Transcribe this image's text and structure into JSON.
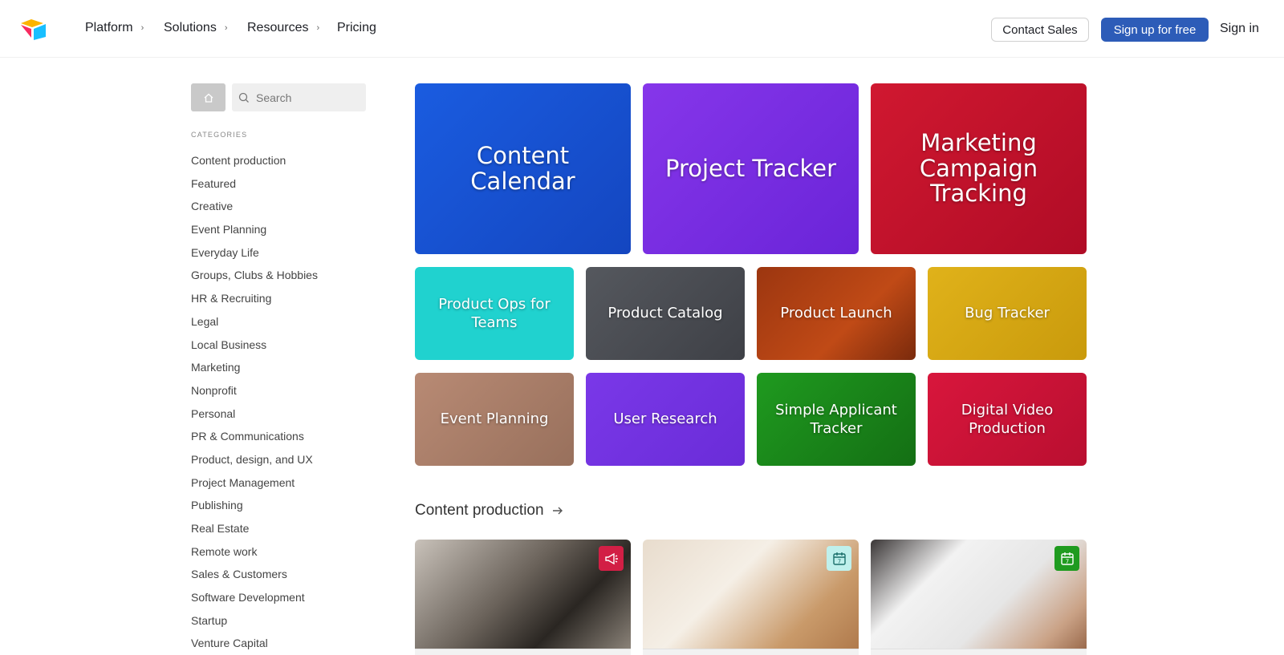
{
  "header": {
    "logo_icon": "airtable-logo-icon",
    "nav": [
      {
        "label": "Platform",
        "has_chevron": true
      },
      {
        "label": "Solutions",
        "has_chevron": true
      },
      {
        "label": "Resources",
        "has_chevron": true
      },
      {
        "label": "Pricing",
        "has_chevron": false
      }
    ],
    "contact_sales": "Contact Sales",
    "signup": "Sign up for free",
    "signin": "Sign in",
    "colors": {
      "signup_bg": "#2d5cb8"
    }
  },
  "sidebar": {
    "home_icon": "home-icon",
    "search_icon": "search-icon",
    "search_placeholder": "Search",
    "categories_label": "CATEGORIES",
    "categories": [
      "Content production",
      "Featured",
      "Creative",
      "Event Planning",
      "Everyday Life",
      "Groups, Clubs & Hobbies",
      "HR & Recruiting",
      "Legal",
      "Local Business",
      "Marketing",
      "Nonprofit",
      "Personal",
      "PR & Communications",
      "Product, design, and UX",
      "Project Management",
      "Publishing",
      "Real Estate",
      "Remote work",
      "Sales & Customers",
      "Software Development",
      "Startup",
      "Venture Capital"
    ]
  },
  "featured": {
    "big": [
      {
        "title": "Content Calendar",
        "color": "#1653d6"
      },
      {
        "title": "Project Tracker",
        "color": "#7a2ee3"
      },
      {
        "title": "Marketing Campaign Tracking",
        "color": "#c8102e"
      }
    ],
    "row2": [
      {
        "title": "Product Ops for Teams",
        "color": "#1fd1d1"
      },
      {
        "title": "Product Catalog",
        "color": "#4d5056"
      },
      {
        "title": "Product Launch",
        "color": "#a23a10"
      },
      {
        "title": "Bug Tracker",
        "color": "#d6a812"
      }
    ],
    "row3": [
      {
        "title": "Event Planning",
        "color": "#a87a66"
      },
      {
        "title": "User Research",
        "color": "#7a35e6"
      },
      {
        "title": "Simple Applicant Tracker",
        "color": "#1c8a1c"
      },
      {
        "title": "Digital Video Production",
        "color": "#d0163a"
      }
    ]
  },
  "section": {
    "title": "Content production",
    "arrow_icon": "arrow-right-icon",
    "cards": [
      {
        "badge_icon": "megaphone-icon",
        "badge_color": "#d21f45"
      },
      {
        "badge_icon": "calendar-icon",
        "badge_color": "#bff0ec"
      },
      {
        "badge_icon": "calendar-icon",
        "badge_color": "#1f9b1f"
      }
    ]
  }
}
